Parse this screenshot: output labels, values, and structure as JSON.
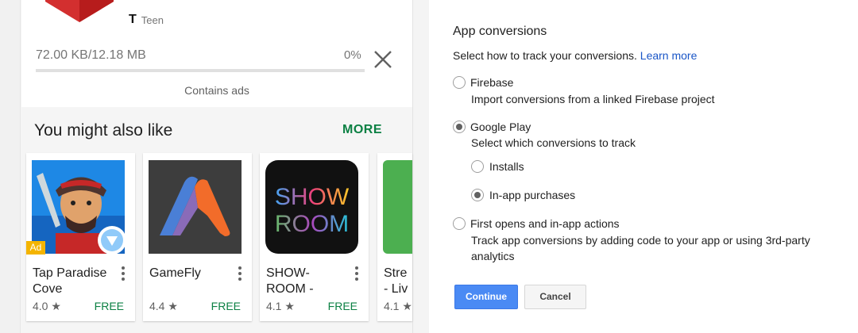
{
  "phone": {
    "content_rating": "Teen",
    "download_progress": "72.00 KB/12.18 MB",
    "download_percent_label": "0%",
    "download_fraction": 0,
    "contains_ads": "Contains ads",
    "section_title": "You might also like",
    "more_label": "MORE",
    "apps": [
      {
        "name": "Tap Paradise Cove",
        "rating": "4.0 ★",
        "price": "FREE",
        "ad_label": "Ad"
      },
      {
        "name": "GameFly",
        "rating": "4.4 ★",
        "price": "FREE"
      },
      {
        "name": "SHOW-ROOM -",
        "rating": "4.1 ★",
        "price": "FREE",
        "icon_text": [
          "SHOW",
          "ROOM"
        ]
      },
      {
        "name": "Stre - Liv",
        "rating": "4.1 ★",
        "price": ""
      }
    ]
  },
  "panel": {
    "title": "App conversions",
    "description": "Select how to track your conversions.",
    "learn_more": "Learn more",
    "options": [
      {
        "label": "Firebase",
        "sub": "Import conversions from a linked Firebase project",
        "selected": false
      },
      {
        "label": "Google Play",
        "sub": "Select which conversions to track",
        "selected": true,
        "sub_options": [
          {
            "label": "Installs",
            "selected": false
          },
          {
            "label": "In-app purchases",
            "selected": true
          }
        ]
      },
      {
        "label": "First opens and in-app actions",
        "sub": "Track app conversions by adding code to your app or using 3rd-party analytics",
        "selected": false
      }
    ],
    "continue_label": "Continue",
    "cancel_label": "Cancel"
  },
  "colors": {
    "accent_blue": "#4a8af4",
    "link_blue": "#1a56c7",
    "play_green": "#0b8043",
    "ad_yellow": "#f4b400"
  },
  "icons": [
    "teen-rating-icon",
    "close-icon",
    "overflow-menu-icon",
    "star-icon",
    "radio-button-icon"
  ]
}
